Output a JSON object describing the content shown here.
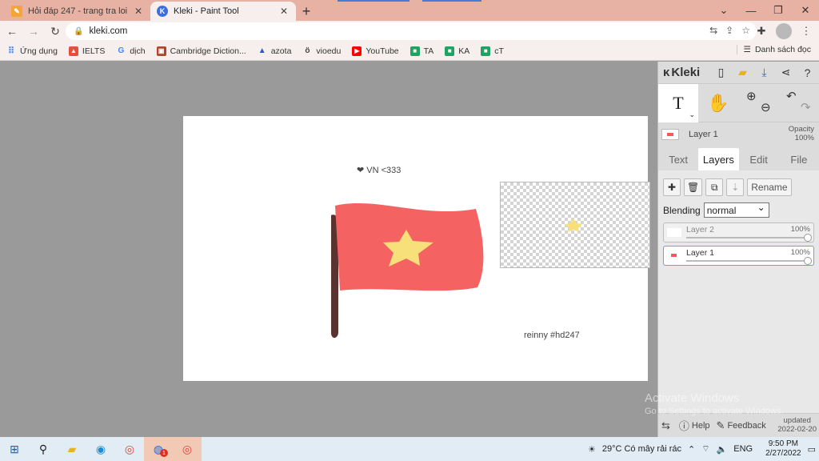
{
  "browser": {
    "tabs": [
      {
        "title": "Hỏi đáp 247 - trang tra loi",
        "favicon": "hoidap-icon",
        "active": false
      },
      {
        "title": "Kleki - Paint Tool",
        "favicon": "kleki-icon",
        "active": true
      }
    ],
    "new_tab": "+",
    "url": "kleki.com",
    "bookmarks": [
      {
        "label": "Ứng dụng",
        "icon": "apps-icon"
      },
      {
        "label": "IELTS",
        "icon": "ielts-icon"
      },
      {
        "label": "dịch",
        "icon": "google-icon"
      },
      {
        "label": "Cambridge Diction...",
        "icon": "cambridge-icon"
      },
      {
        "label": "azota",
        "icon": "azota-icon"
      },
      {
        "label": "vioedu",
        "icon": "vioedu-icon"
      },
      {
        "label": "YouTube",
        "icon": "youtube-icon"
      },
      {
        "label": "TA",
        "icon": "meet-icon"
      },
      {
        "label": "KA",
        "icon": "meet-icon"
      },
      {
        "label": "cT",
        "icon": "meet-icon"
      }
    ],
    "reading_list": "Danh sách đọc"
  },
  "canvas": {
    "text_top": "❤ VN <333",
    "text_bottom": "reinny #hd247"
  },
  "kleki": {
    "logo": "Kleki",
    "active_layer_name": "Layer 1",
    "opacity_label": "Opacity",
    "opacity_value": "100%",
    "tabs": [
      "Text",
      "Layers",
      "Edit",
      "File"
    ],
    "active_tab": "Layers",
    "rename_label": "Rename",
    "blending_label": "Blending",
    "blending_value": "normal",
    "layers": [
      {
        "name": "Layer 2",
        "opacity": "100%",
        "selected": false
      },
      {
        "name": "Layer 1",
        "opacity": "100%",
        "selected": true
      }
    ],
    "help_label": "Help",
    "feedback_label": "Feedback",
    "updated_label": "updated",
    "updated_date": "2022-02-20"
  },
  "watermark": {
    "title": "Activate Windows",
    "subtitle": "Go to Settings to activate Windows."
  },
  "taskbar": {
    "weather": "29°C  Có mây rải rác",
    "lang": "ENG",
    "time": "9:50 PM",
    "date": "2/27/2022",
    "badge": "1"
  },
  "colors": {
    "flag": "#f46262",
    "star": "#f7e07a",
    "pole": "#5a3330",
    "tab_strip": "#e7b2a3"
  }
}
